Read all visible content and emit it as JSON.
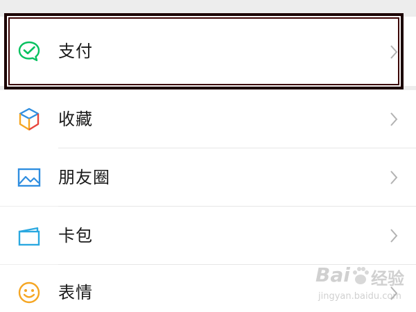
{
  "menu": {
    "items": [
      {
        "label": "支付",
        "icon": "wechat-pay-icon"
      },
      {
        "label": "收藏",
        "icon": "favorites-cube-icon"
      },
      {
        "label": "朋友圈",
        "icon": "moments-image-icon"
      },
      {
        "label": "卡包",
        "icon": "card-wallet-icon"
      },
      {
        "label": "表情",
        "icon": "smiley-face-icon"
      }
    ]
  },
  "colors": {
    "pay_green": "#07c160",
    "moments_blue": "#2f8ee0",
    "card_blue": "#2aa8e0",
    "emoji_orange": "#f5a623",
    "highlight_border": "#1b0000",
    "chevron": "#b2b2b2"
  },
  "watermark": {
    "brand": "Bai",
    "brand_suffix": "经验",
    "url": "jingyan.baidu.com"
  }
}
